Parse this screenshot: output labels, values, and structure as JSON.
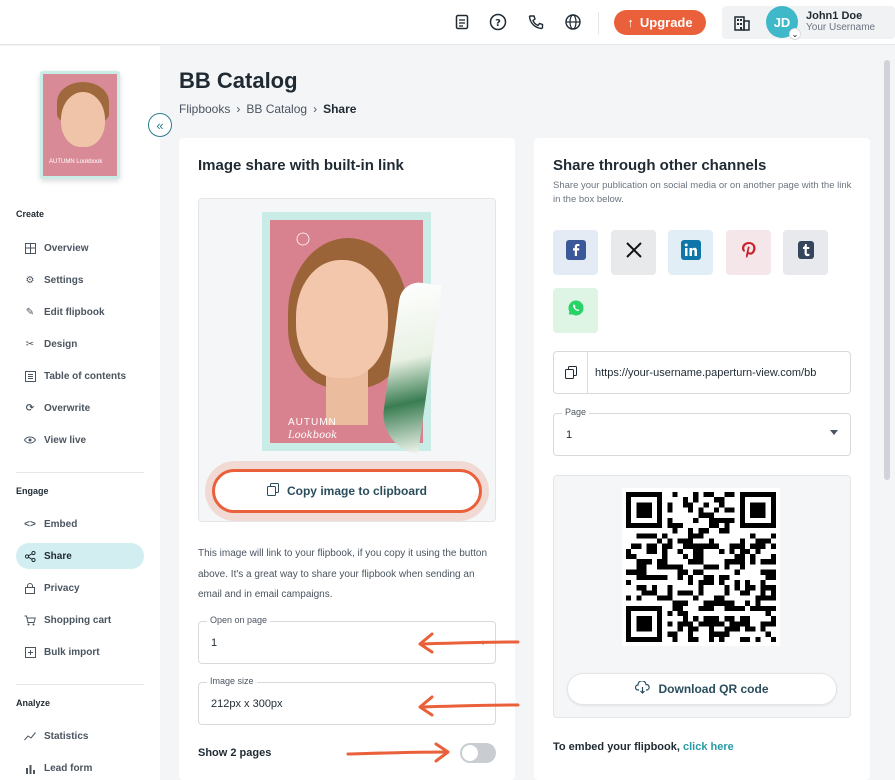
{
  "topbar": {
    "upgrade_label": "Upgrade",
    "avatar_initials": "JD",
    "user_name": "John1 Doe",
    "user_sub": "Your Username"
  },
  "sidebar": {
    "thumb_text": "AUTUMN Lookbook",
    "sections": {
      "create": "Create",
      "engage": "Engage",
      "analyze": "Analyze"
    },
    "create_items": [
      "Overview",
      "Settings",
      "Edit flipbook",
      "Design",
      "Table of contents",
      "Overwrite",
      "View live"
    ],
    "engage_items": [
      "Embed",
      "Share",
      "Privacy",
      "Shopping cart",
      "Bulk import"
    ],
    "analyze_items": [
      "Statistics",
      "Lead form"
    ],
    "active": "Share"
  },
  "main": {
    "title": "BB Catalog",
    "breadcrumb": [
      "Flipbooks",
      "BB Catalog",
      "Share"
    ]
  },
  "image_share": {
    "title": "Image share with built-in link",
    "cover_title": "AUTUMN",
    "cover_sub": "Lookbook",
    "copy_label": "Copy image to clipboard",
    "description": "This image will link to your flipbook, if you copy it using the button above. It's a great way to share your flipbook when sending an email and in email campaigns.",
    "open_on_page_label": "Open on page",
    "open_on_page_value": "1",
    "image_size_label": "Image size",
    "image_size_value": "212px x 300px",
    "show_two_pages_label": "Show 2 pages",
    "show_two_pages": false
  },
  "other_channels": {
    "title": "Share through other channels",
    "subtitle": "Share your publication on social media or on another page with the link in the box below.",
    "link": "https://your-username.paperturn-view.com/bb",
    "page_label": "Page",
    "page_value": "1",
    "download_label": "Download QR code",
    "embed_text": "To embed your flipbook, ",
    "embed_link": "click here"
  },
  "colors": {
    "accent": "#e9603a",
    "teal": "#2a9aa6",
    "active_bg": "#d3eef1"
  }
}
